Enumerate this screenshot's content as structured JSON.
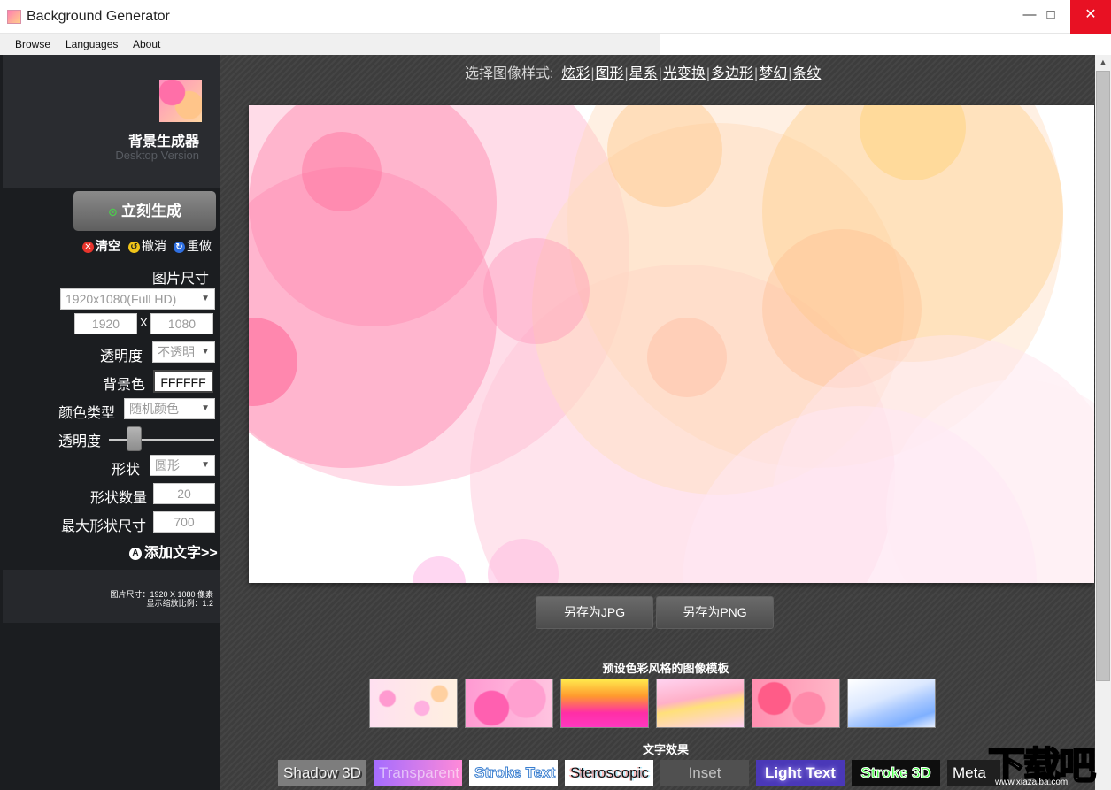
{
  "window": {
    "title": "Background Generator",
    "controls": {
      "minimize": "—",
      "maximize": "□",
      "close": "✕"
    }
  },
  "menu": {
    "items": [
      "Browse",
      "Languages",
      "About"
    ]
  },
  "sidebar": {
    "app_title": "背景生成器",
    "app_subtitle": "Desktop Version",
    "generate_label": "立刻生成",
    "actions": {
      "clear": "清空",
      "undo": "撤消",
      "redo": "重做"
    },
    "image_size_label": "图片尺寸",
    "image_size_selected": "1920x1080(Full HD)",
    "width": "1920",
    "height": "1080",
    "size_separator": "X",
    "opacity_label": "透明度",
    "opacity_selected": "不透明",
    "bg_color_label": "背景色",
    "bg_color_value": "FFFFFF",
    "color_type_label": "颜色类型",
    "color_type_selected": "随机颜色",
    "shape_opacity_label": "透明度",
    "shape_label": "形状",
    "shape_selected": "圆形",
    "shape_count_label": "形状数量",
    "shape_count_value": "20",
    "max_shape_size_label": "最大形状尺寸",
    "max_shape_size_value": "700",
    "add_text_label": "添加文字>>",
    "info_size": "图片尺寸：1920 X 1080 像素",
    "info_scale": "显示缩放比例：1:2"
  },
  "main": {
    "style_prompt": "选择图像样式:",
    "styles": [
      "炫彩",
      "图形",
      "星系",
      "光变换",
      "多边形",
      "梦幻",
      "条纹"
    ],
    "save_jpg": "另存为JPG",
    "save_png": "另存为PNG",
    "templates_title": "预设色彩风格的图像模板",
    "text_effects_title": "文字效果",
    "effects": [
      "Shadow 3D",
      "Transparent",
      "Stroke Text",
      "Steroscopic",
      "Inset",
      "Light Text",
      "Stroke 3D",
      "Meta"
    ]
  },
  "watermark": {
    "main": "下载吧",
    "sub": "www.xiazaiba.com"
  },
  "colors": {
    "sidebar_bg": "#1b1d20",
    "main_bg": "#3d3d3d",
    "close_red": "#e81123",
    "generate_icon": "#4ec94e",
    "clear_icon": "#e8342c",
    "undo_icon": "#f0c419",
    "redo_icon": "#2f6fe0"
  }
}
